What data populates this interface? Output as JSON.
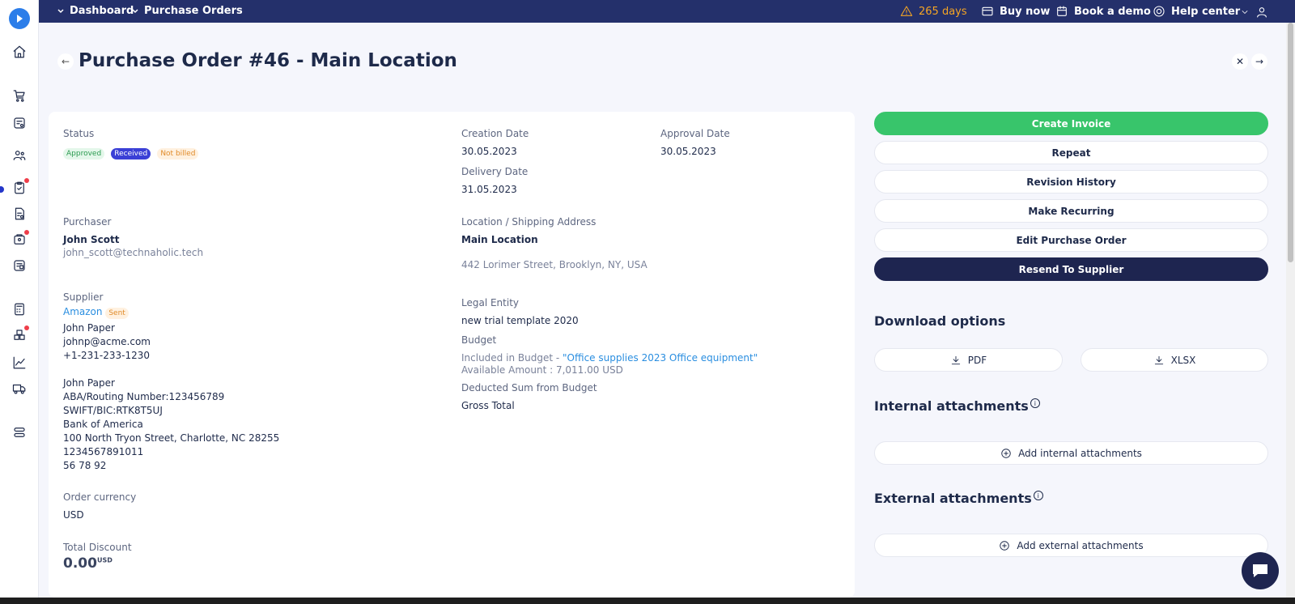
{
  "breadcrumb": [
    "Dashboard",
    "Purchase Orders"
  ],
  "topbar": {
    "trial": "265 days",
    "buy_now": "Buy now",
    "book_demo": "Book a demo",
    "help_center": "Help center"
  },
  "page": {
    "title": "Purchase Order #46 - Main Location"
  },
  "status": {
    "label": "Status",
    "badges": [
      "Approved",
      "Received",
      "Not billed"
    ]
  },
  "creation": {
    "label": "Creation Date",
    "value": "30.05.2023"
  },
  "approval": {
    "label": "Approval Date",
    "value": "30.05.2023"
  },
  "delivery": {
    "label": "Delivery Date",
    "value": "31.05.2023"
  },
  "purchaser": {
    "label": "Purchaser",
    "name": "John Scott",
    "email": "john_scott@technaholic.tech"
  },
  "location": {
    "label": "Location / Shipping Address",
    "name": "Main Location",
    "address": "442 Lorimer Street, Brooklyn, NY, USA"
  },
  "supplier": {
    "label": "Supplier",
    "name": "Amazon",
    "badge": "Sent",
    "contact": "John Paper",
    "email": "johnp@acme.com",
    "phone": "+1-231-233-1230",
    "bank_lines": [
      "John Paper",
      "ABA/Routing Number:123456789",
      "SWIFT/BIC:RTK8T5UJ",
      "Bank of America",
      "100 North Tryon Street, Charlotte, NC 28255",
      "1234567891011",
      "56 78 92"
    ]
  },
  "legal_entity": {
    "label": "Legal Entity",
    "value": "new trial template 2020"
  },
  "budget": {
    "label": "Budget",
    "included_prefix": "Included in Budget - ",
    "included_link": "\"Office supplies 2023 Office equipment\"",
    "available": "Available Amount : 7,011.00 USD"
  },
  "deducted": {
    "label": "Deducted Sum from Budget",
    "value": "Gross Total"
  },
  "currency": {
    "label": "Order currency",
    "value": "USD"
  },
  "discount": {
    "label": "Total Discount",
    "value": "0.00",
    "unit": "USD"
  },
  "actions": {
    "create_invoice": "Create Invoice",
    "repeat": "Repeat",
    "revision_history": "Revision History",
    "make_recurring": "Make Recurring",
    "edit_po": "Edit Purchase Order",
    "resend": "Resend To Supplier"
  },
  "download": {
    "title": "Download options",
    "pdf": "PDF",
    "xlsx": "XLSX"
  },
  "internal": {
    "title": "Internal attachments",
    "add": "Add internal attachments"
  },
  "external": {
    "title": "External attachments",
    "add": "Add external attachments"
  },
  "colors": {
    "primary_navy": "#24306b",
    "green": "#38c56b",
    "link": "#2a8ee0"
  }
}
